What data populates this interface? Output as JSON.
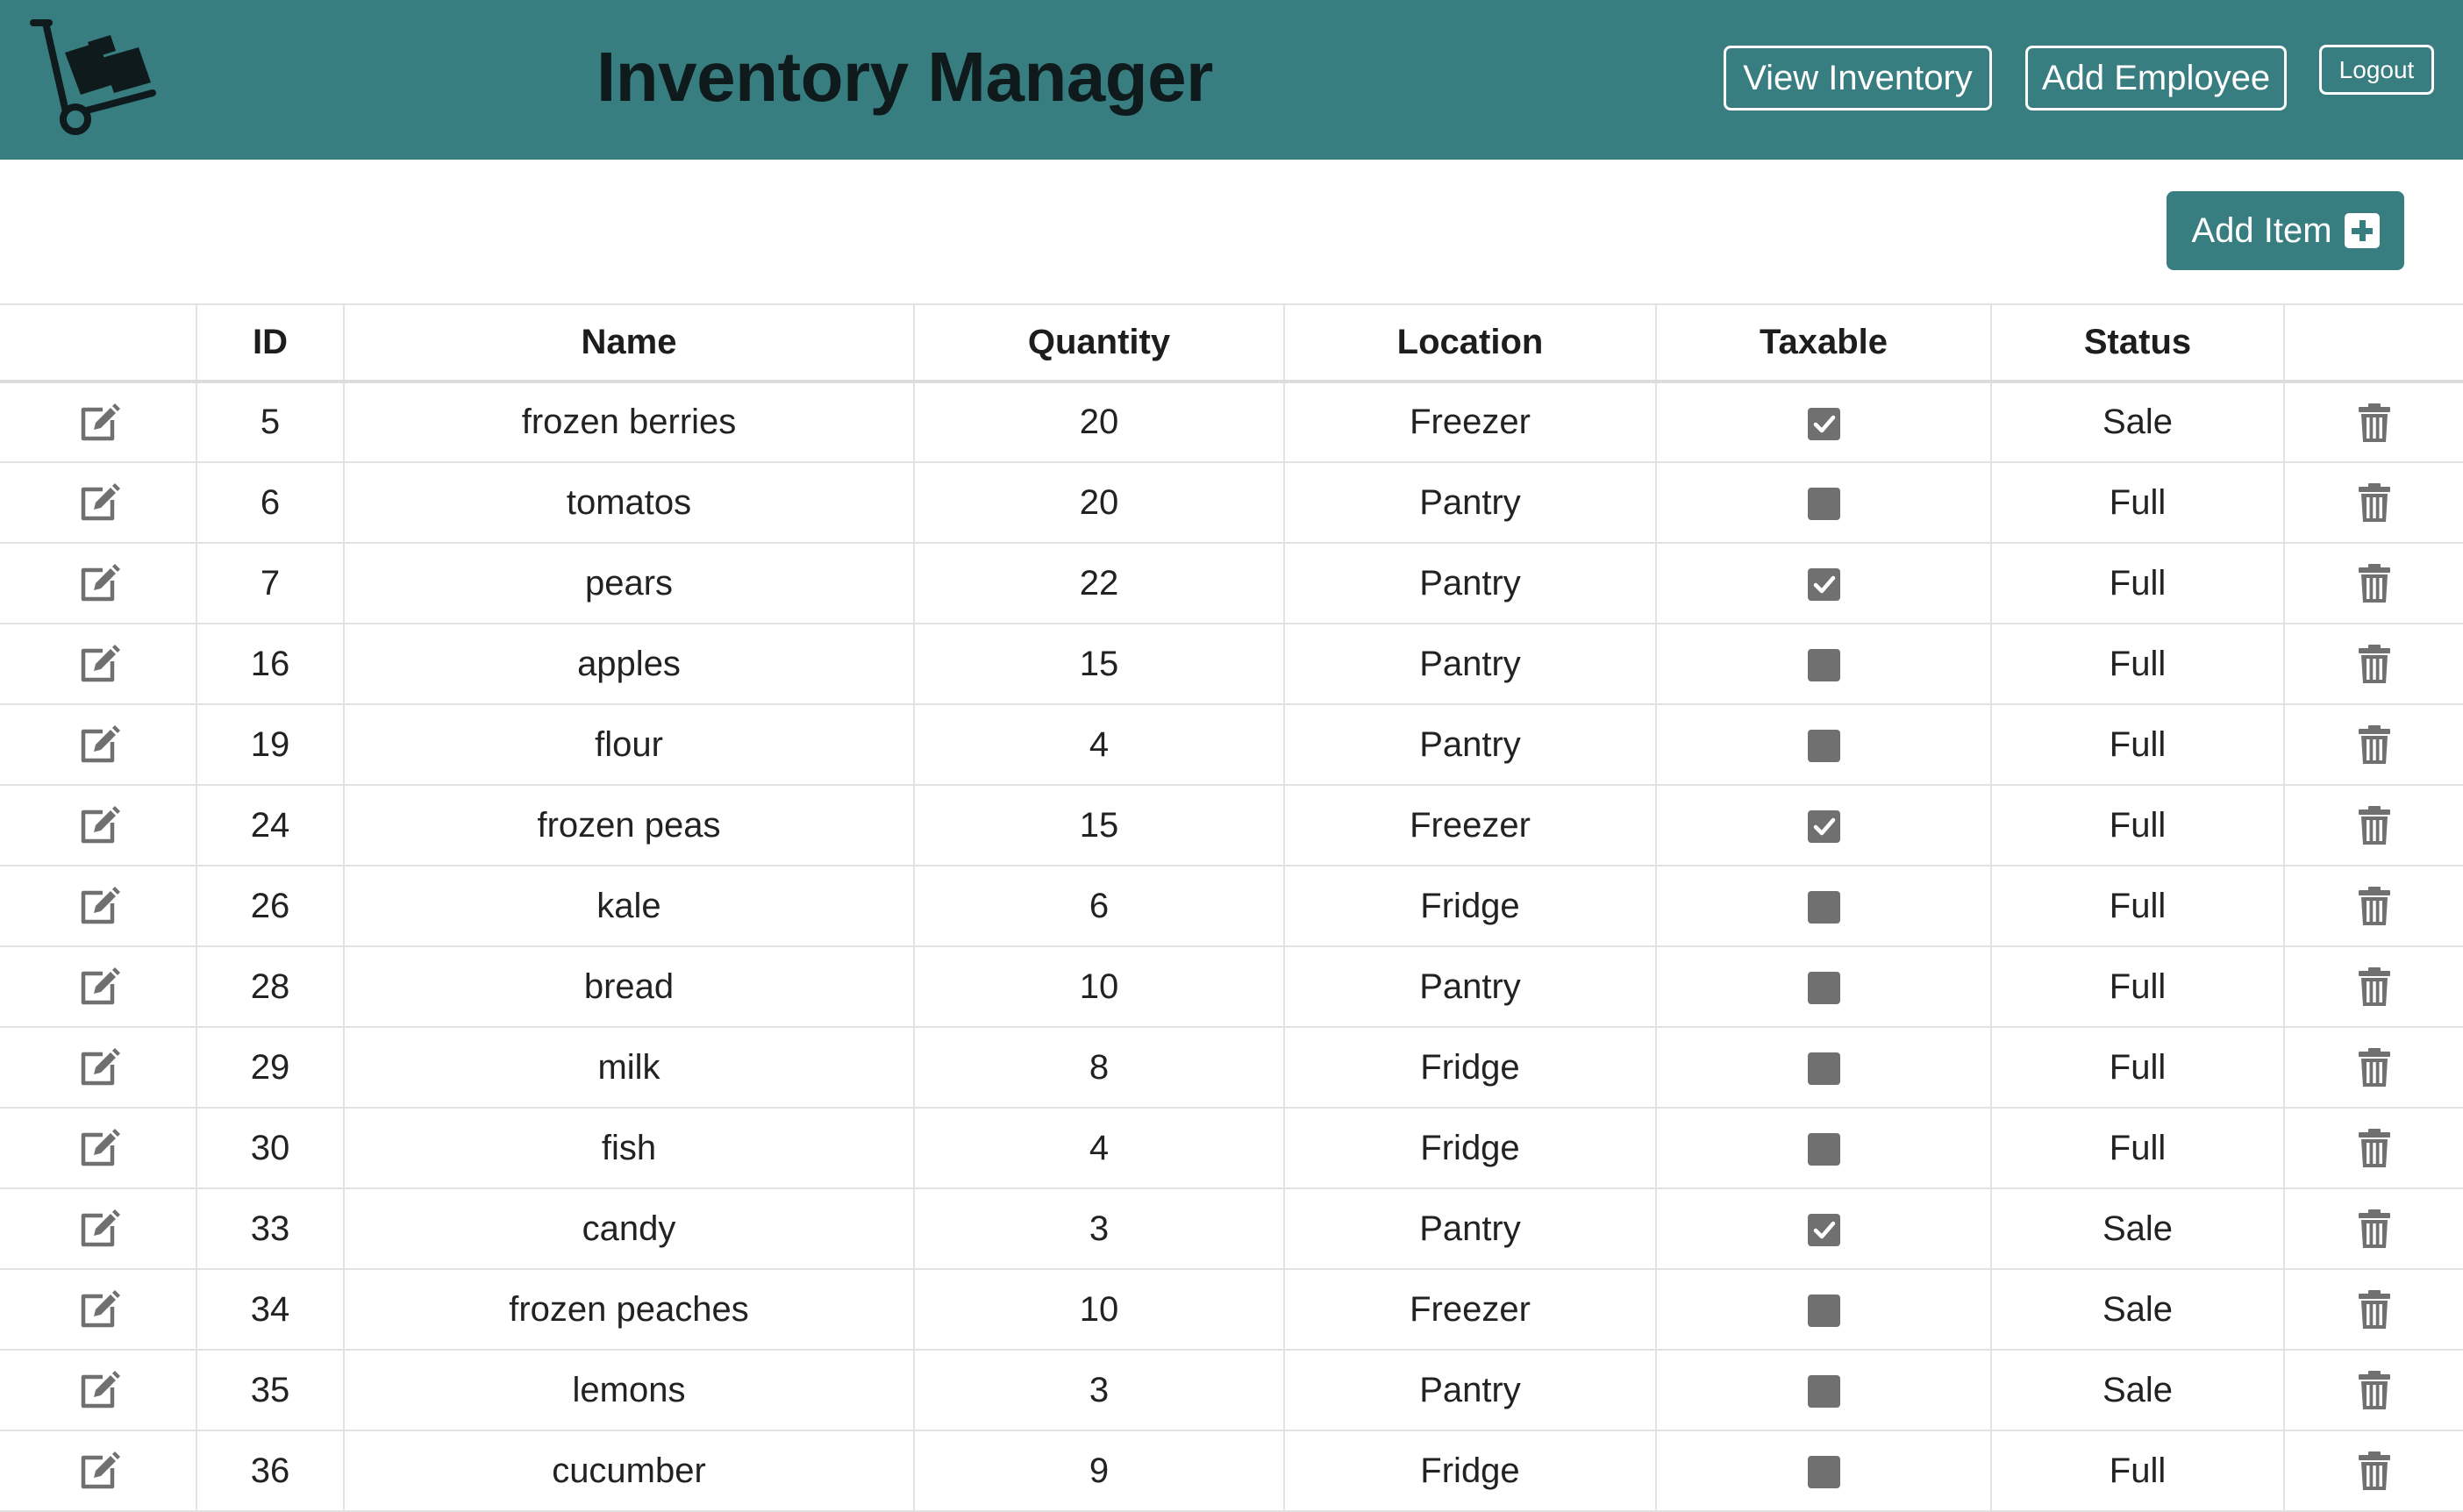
{
  "header": {
    "title": "Inventory Manager",
    "logo_icon": "hand-truck-icon",
    "nav": {
      "view_inventory": "View Inventory",
      "add_employee": "Add Employee",
      "logout": "Logout"
    }
  },
  "actions": {
    "add_item_label": "Add Item",
    "add_item_icon": "plus-square-icon"
  },
  "colors": {
    "brand": "#387d80",
    "icon_gray": "#707070"
  },
  "table": {
    "columns": [
      "",
      "ID",
      "Name",
      "Quantity",
      "Location",
      "Taxable",
      "Status",
      ""
    ],
    "edit_icon": "edit-icon",
    "delete_icon": "trash-icon",
    "rows": [
      {
        "id": "5",
        "name": "frozen berries",
        "quantity": "20",
        "location": "Freezer",
        "taxable": true,
        "status": "Sale"
      },
      {
        "id": "6",
        "name": "tomatos",
        "quantity": "20",
        "location": "Pantry",
        "taxable": false,
        "status": "Full"
      },
      {
        "id": "7",
        "name": "pears",
        "quantity": "22",
        "location": "Pantry",
        "taxable": true,
        "status": "Full"
      },
      {
        "id": "16",
        "name": "apples",
        "quantity": "15",
        "location": "Pantry",
        "taxable": false,
        "status": "Full"
      },
      {
        "id": "19",
        "name": "flour",
        "quantity": "4",
        "location": "Pantry",
        "taxable": false,
        "status": "Full"
      },
      {
        "id": "24",
        "name": "frozen peas",
        "quantity": "15",
        "location": "Freezer",
        "taxable": true,
        "status": "Full"
      },
      {
        "id": "26",
        "name": "kale",
        "quantity": "6",
        "location": "Fridge",
        "taxable": false,
        "status": "Full"
      },
      {
        "id": "28",
        "name": "bread",
        "quantity": "10",
        "location": "Pantry",
        "taxable": false,
        "status": "Full"
      },
      {
        "id": "29",
        "name": "milk",
        "quantity": "8",
        "location": "Fridge",
        "taxable": false,
        "status": "Full"
      },
      {
        "id": "30",
        "name": "fish",
        "quantity": "4",
        "location": "Fridge",
        "taxable": false,
        "status": "Full"
      },
      {
        "id": "33",
        "name": "candy",
        "quantity": "3",
        "location": "Pantry",
        "taxable": true,
        "status": "Sale"
      },
      {
        "id": "34",
        "name": "frozen peaches",
        "quantity": "10",
        "location": "Freezer",
        "taxable": false,
        "status": "Sale"
      },
      {
        "id": "35",
        "name": "lemons",
        "quantity": "3",
        "location": "Pantry",
        "taxable": false,
        "status": "Sale"
      },
      {
        "id": "36",
        "name": "cucumber",
        "quantity": "9",
        "location": "Fridge",
        "taxable": false,
        "status": "Full"
      }
    ]
  }
}
